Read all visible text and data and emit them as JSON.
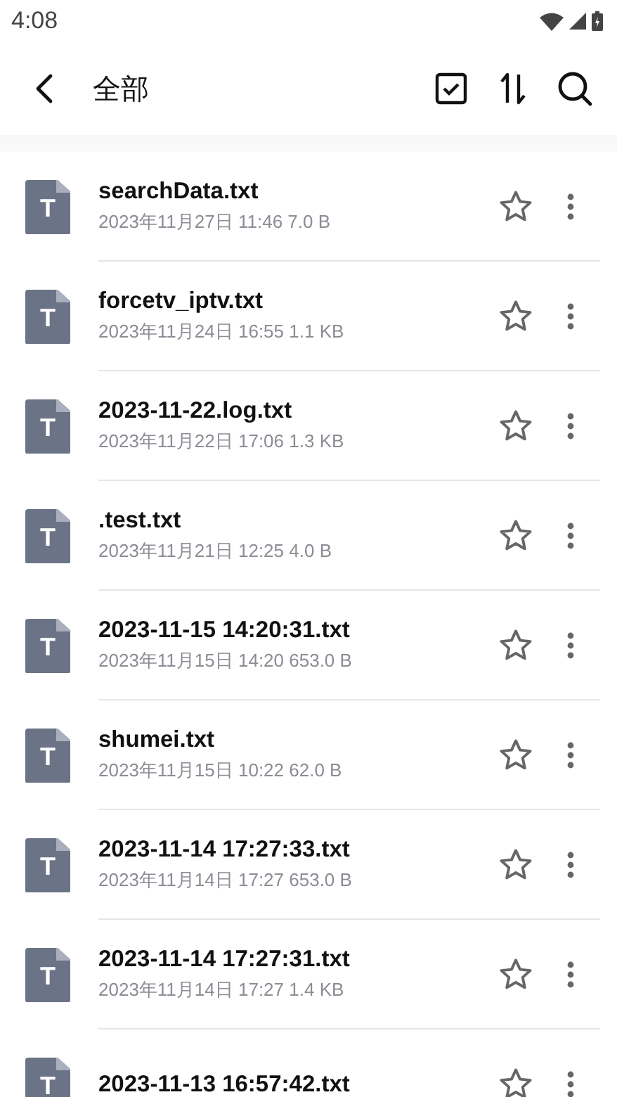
{
  "status_bar": {
    "time": "4:08"
  },
  "app_bar": {
    "title": "全部"
  },
  "files": [
    {
      "icon_label": "T",
      "name": "searchData.txt",
      "meta": "2023年11月27日 11:46 7.0 B",
      "starred": false
    },
    {
      "icon_label": "T",
      "name": "forcetv_iptv.txt",
      "meta": "2023年11月24日 16:55 1.1 KB",
      "starred": false
    },
    {
      "icon_label": "T",
      "name": "2023-11-22.log.txt",
      "meta": "2023年11月22日 17:06 1.3 KB",
      "starred": false
    },
    {
      "icon_label": "T",
      "name": ".test.txt",
      "meta": "2023年11月21日 12:25 4.0 B",
      "starred": false
    },
    {
      "icon_label": "T",
      "name": "2023-11-15 14:20:31.txt",
      "meta": "2023年11月15日 14:20 653.0 B",
      "starred": false
    },
    {
      "icon_label": "T",
      "name": "shumei.txt",
      "meta": "2023年11月15日 10:22 62.0 B",
      "starred": false
    },
    {
      "icon_label": "T",
      "name": "2023-11-14 17:27:33.txt",
      "meta": "2023年11月14日 17:27 653.0 B",
      "starred": false
    },
    {
      "icon_label": "T",
      "name": "2023-11-14 17:27:31.txt",
      "meta": "2023年11月14日 17:27 1.4 KB",
      "starred": false
    },
    {
      "icon_label": "T",
      "name": "2023-11-13 16:57:42.txt",
      "starred": false
    }
  ]
}
